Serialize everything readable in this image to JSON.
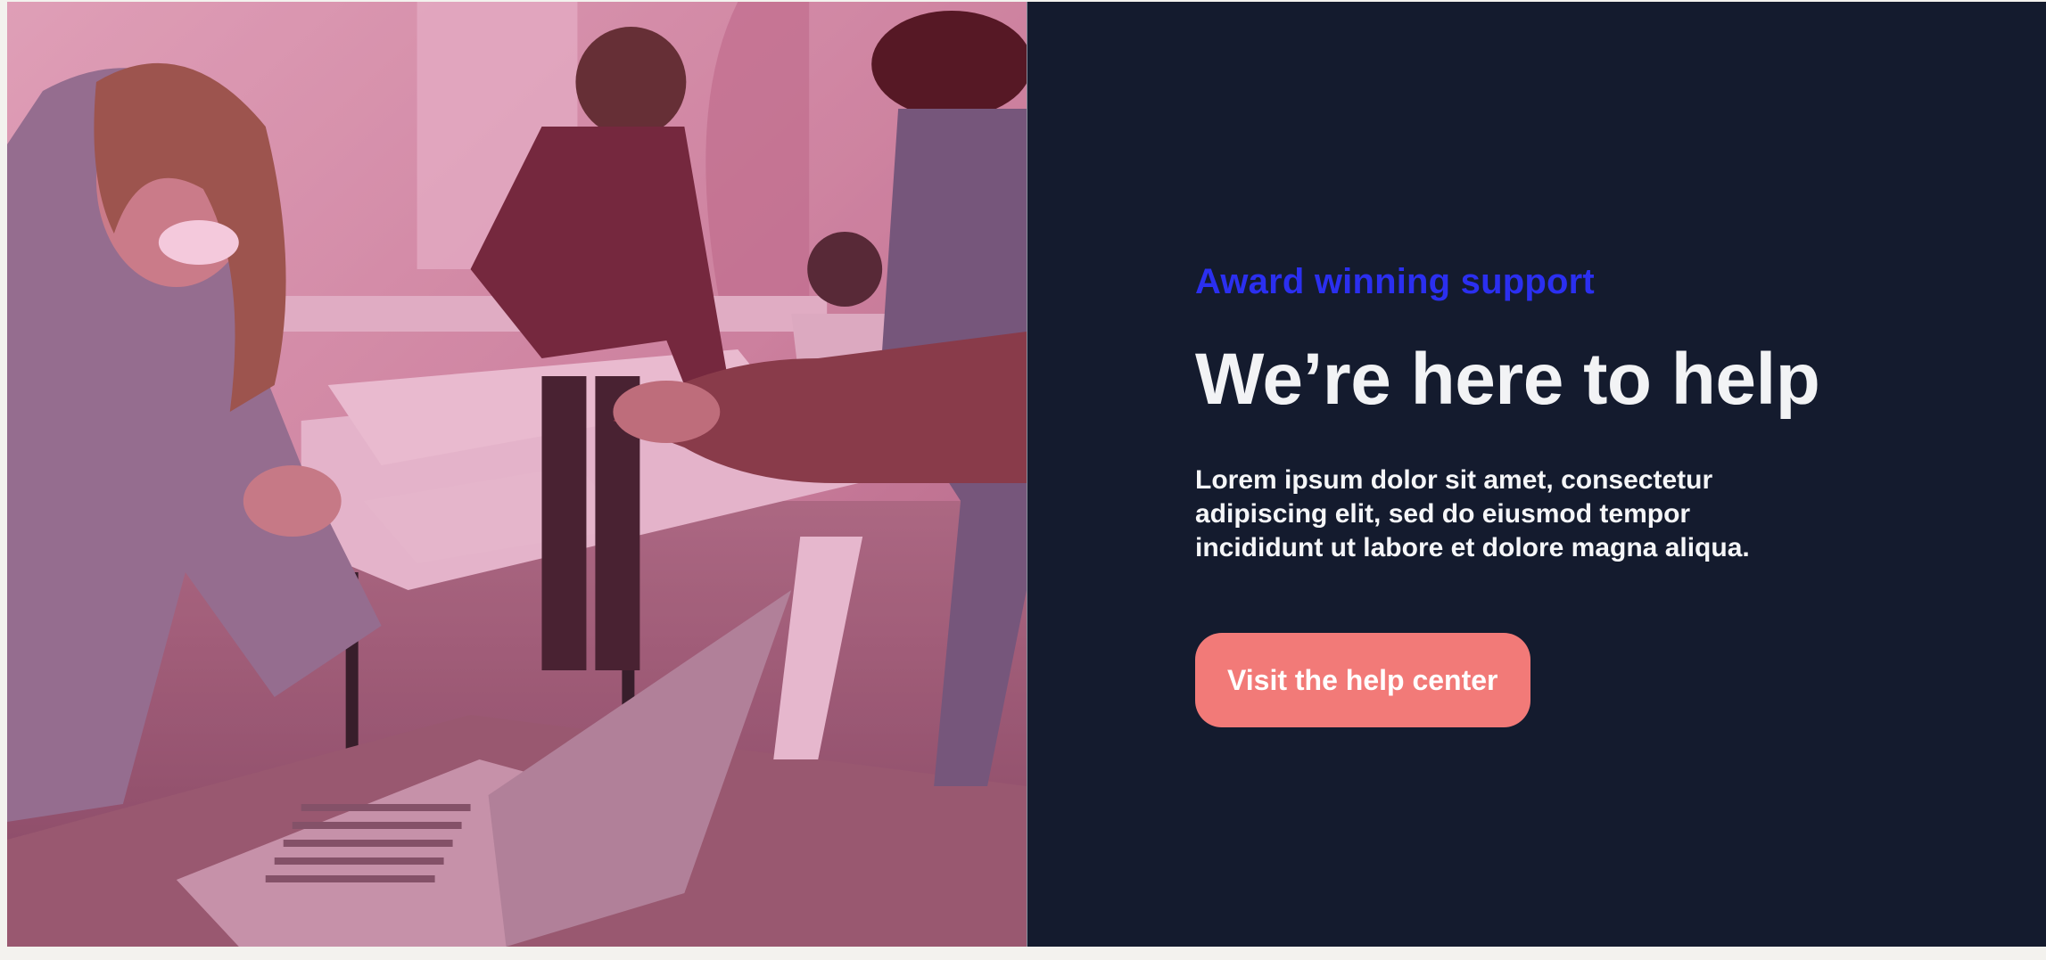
{
  "hero": {
    "eyebrow": "Award winning support",
    "title": "We’re here to help",
    "description": "Lorem ipsum dolor sit amet, consectetur adipiscing elit, sed do eiusmod tempor incididunt ut labore et dolore magna aliqua.",
    "cta_label": "Visit the help center"
  },
  "colors": {
    "panel_background": "#141b2e",
    "eyebrow": "#2b2ff0",
    "heading": "#f2f3f5",
    "cta_background": "#f27a78",
    "photo_overlay": "#d63c82"
  }
}
